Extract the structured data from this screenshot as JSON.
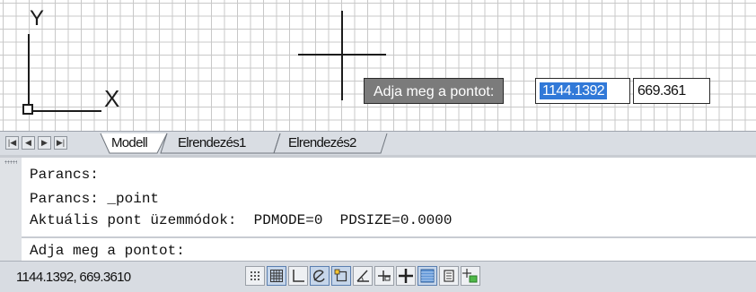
{
  "canvas": {
    "ucs_axes": {
      "x_label": "X",
      "y_label": "Y"
    },
    "dynamic_input": {
      "prompt": "Adja meg a pontot:",
      "x_value": "1144.1392",
      "y_value": "669.361"
    }
  },
  "layout_tabs": {
    "nav": [
      "first",
      "previous",
      "next",
      "last"
    ],
    "tabs": [
      {
        "label": "Modell",
        "active": true
      },
      {
        "label": "Elrendezés1",
        "active": false
      },
      {
        "label": "Elrendezés2",
        "active": false
      }
    ]
  },
  "command_line": {
    "history": [
      "Parancs:",
      "Parancs: _point",
      "Aktuális pont üzemmódok:  PDMODE=0  PDSIZE=0.0000"
    ],
    "prompt": "Adja meg a pontot:"
  },
  "status_bar": {
    "coordinates": "1144.1392, 669.3610",
    "toggles": [
      {
        "name": "snap-icon",
        "on": false
      },
      {
        "name": "grid-icon",
        "on": true
      },
      {
        "name": "ortho-icon",
        "on": false
      },
      {
        "name": "polar-icon",
        "on": true
      },
      {
        "name": "osnap-icon",
        "on": true
      },
      {
        "name": "otrack-icon",
        "on": false
      },
      {
        "name": "ducs-icon",
        "on": false
      },
      {
        "name": "dyn-icon",
        "on": false
      },
      {
        "name": "lineweight-icon",
        "on": true
      },
      {
        "name": "quick-properties-icon",
        "on": false
      },
      {
        "name": "selection-cycling-icon",
        "on": false
      }
    ]
  },
  "colors": {
    "grid": "#c8c8c8",
    "tooltip_bg": "#7b7b7b",
    "selection": "#3179d8",
    "statusbar_bg": "#d8dce2"
  }
}
